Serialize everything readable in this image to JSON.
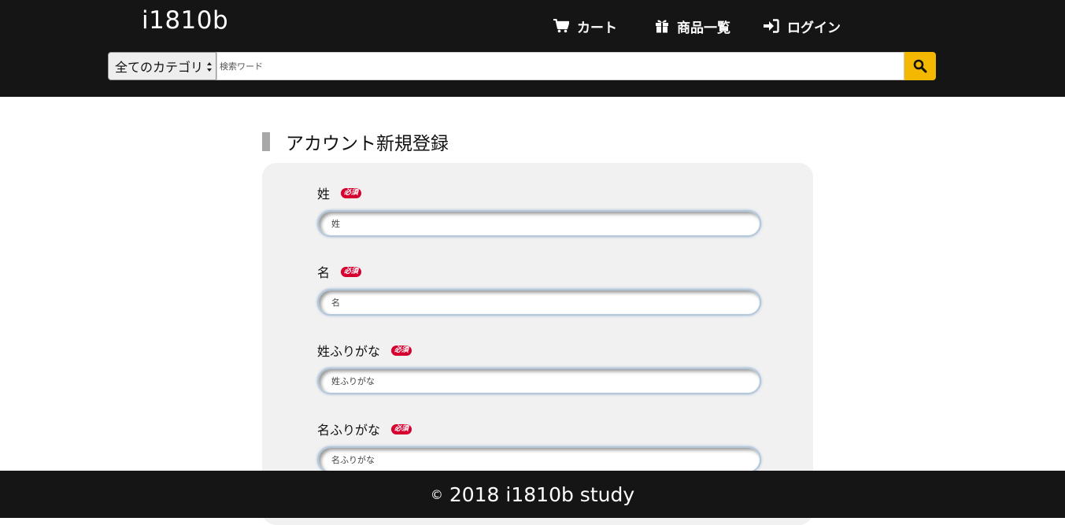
{
  "header": {
    "logo": "i1810b",
    "nav": {
      "cart": "カート",
      "products": "商品一覧",
      "login": "ログイン"
    },
    "search": {
      "category_selected": "全てのカテゴリ",
      "placeholder": "検索ワード",
      "button_icon": "search-icon"
    }
  },
  "main": {
    "title": "アカウント新規登録",
    "required_badge": "必須",
    "fields": [
      {
        "label": "姓",
        "placeholder": "姓"
      },
      {
        "label": "名",
        "placeholder": "名"
      },
      {
        "label": "姓ふりがな",
        "placeholder": "姓ふりがな"
      },
      {
        "label": "名ふりがな",
        "placeholder": "名ふりがな"
      }
    ]
  },
  "footer": {
    "copyright_symbol": "©",
    "text": "2018 i1810b study"
  },
  "colors": {
    "header_bg": "#151515",
    "search_button": "#f5b800",
    "required_badge": "#d6002f",
    "panel_bg": "#f1f1f1"
  }
}
